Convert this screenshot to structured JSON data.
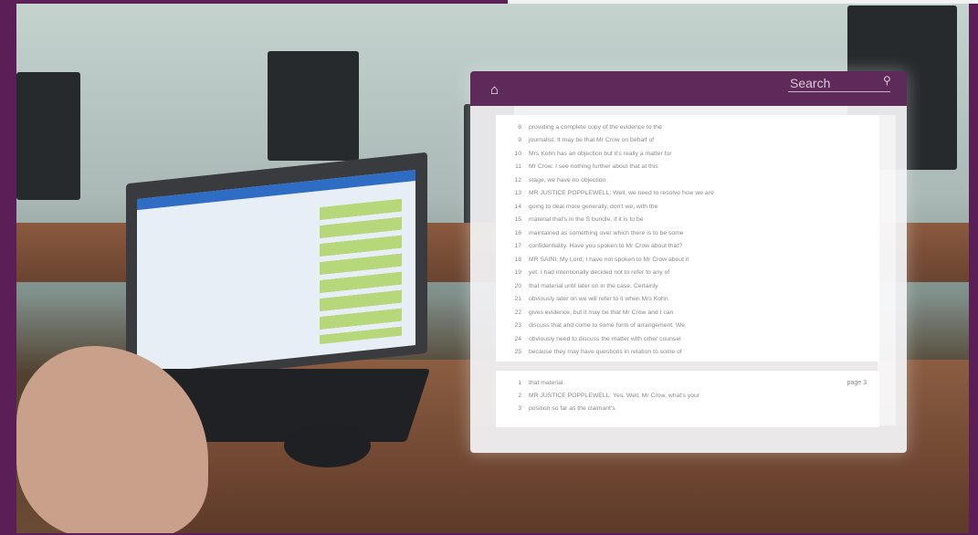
{
  "overlay": {
    "search_placeholder": "Search",
    "page_label": "page 3"
  },
  "transcript_lines": [
    {
      "n": "8",
      "t": "providing a complete copy of the evidence to the"
    },
    {
      "n": "9",
      "t": "journalist.  It may be that Mr Crow on behalf of"
    },
    {
      "n": "10",
      "t": "Mrs Kohn has an objection but it's really a matter for"
    },
    {
      "n": "11",
      "t": "Mr Crow. I see nothing further about that at this"
    },
    {
      "n": "12",
      "t": "stage, we have no objection."
    },
    {
      "n": "13",
      "t": "MR JUSTICE POPPLEWELL:  Well, we need to resolve how we are"
    },
    {
      "n": "14",
      "t": "going to deal more generally, don't we, with the"
    },
    {
      "n": "15",
      "t": "material that's in the S bundle, if it is to be"
    },
    {
      "n": "16",
      "t": "maintained as something over which there is to be some"
    },
    {
      "n": "17",
      "t": "confidentiality.  Have you spoken to Mr Crow about that?"
    },
    {
      "n": "18",
      "t": "MR SAINI:  My Lord, I have not spoken to Mr Crow about it"
    },
    {
      "n": "19",
      "t": "yet.  I had intentionally decided not to refer to any of"
    },
    {
      "n": "20",
      "t": "that material until later on in the case.  Certainly"
    },
    {
      "n": "21",
      "t": "obviously later on we will refer to it when Mrs Kohn"
    },
    {
      "n": "22",
      "t": "gives evidence, but it may be that Mr Crow and I can"
    },
    {
      "n": "23",
      "t": "discuss that and come to some form of arrangement.  We"
    },
    {
      "n": "24",
      "t": "obviously need to discuss the matter with other counsel"
    },
    {
      "n": "25",
      "t": "because they may have questions in relation to some of"
    }
  ],
  "page2_lines": [
    {
      "n": "1",
      "t": "that material."
    },
    {
      "n": "2",
      "t": "MR JUSTICE POPPLEWELL:  Yes.  Well, Mr Crow, what's your"
    },
    {
      "n": "3",
      "t": "position so far as the claimant's"
    }
  ],
  "colors": {
    "accent": "#5e2a5a",
    "frame": "#5b1e57"
  }
}
